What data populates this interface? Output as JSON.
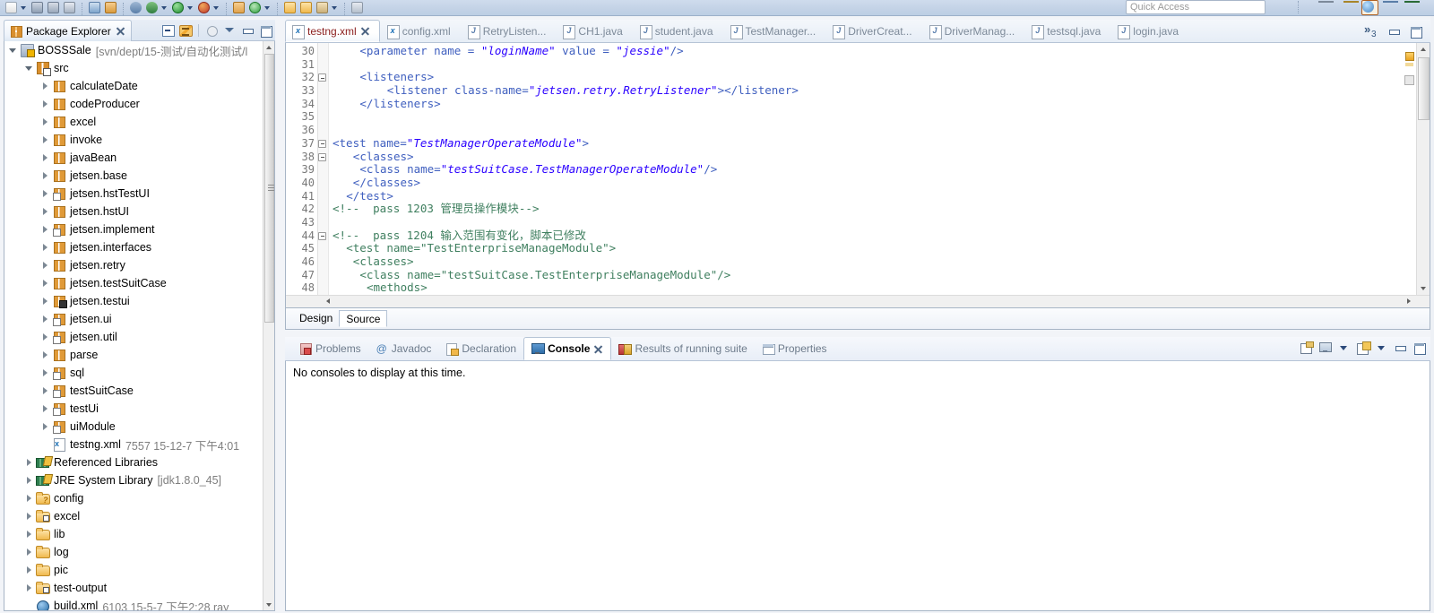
{
  "toolbar": {
    "quick_access_placeholder": "Quick Access",
    "icons": [
      "new-file-icon",
      "new-dropdown-arrow",
      "save-icon",
      "save-all-icon",
      "print-icon",
      "export-icon",
      "package-icon",
      "debug-icon",
      "debug-dropdown-arrow",
      "run-icon",
      "run-dropdown-arrow",
      "run-coverage-icon",
      "coverage-dropdown-arrow",
      "new-java-package-icon",
      "refresh-icon",
      "refresh-dropdown-arrow",
      "open-type-icon",
      "open-resource-icon",
      "search-icon",
      "search-dropdown-arrow",
      "edit-icon"
    ],
    "right_icons": [
      "new-window-icon",
      "open-perspective-icon",
      "java-perspective-icon",
      "java-ee-perspective-icon",
      "debug-perspective-icon"
    ]
  },
  "package_explorer": {
    "tab_label": "Package Explorer",
    "tools": [
      "collapse-all-icon",
      "link-with-editor-icon",
      "focus-on-active-task-icon",
      "view-menu-icon",
      "minimize-icon",
      "maximize-icon"
    ],
    "tree": [
      {
        "indent": 0,
        "twist": "open",
        "icon": "project-icon",
        "label": "BOSSSale",
        "sub": "[svn/dept/15-测试/自动化测试/l"
      },
      {
        "indent": 1,
        "twist": "open",
        "icon": "source-folder-icon",
        "label": "src",
        "sub": ""
      },
      {
        "indent": 2,
        "twist": "closed",
        "icon": "package-icon",
        "label": "calculateDate",
        "sub": ""
      },
      {
        "indent": 2,
        "twist": "closed",
        "icon": "package-icon",
        "label": "codeProducer",
        "sub": ""
      },
      {
        "indent": 2,
        "twist": "closed",
        "icon": "package-icon",
        "label": "excel",
        "sub": ""
      },
      {
        "indent": 2,
        "twist": "closed",
        "icon": "package-icon",
        "label": "invoke",
        "sub": ""
      },
      {
        "indent": 2,
        "twist": "closed",
        "icon": "package-icon",
        "label": "javaBean",
        "sub": ""
      },
      {
        "indent": 2,
        "twist": "closed",
        "icon": "package-icon",
        "label": "jetsen.base",
        "sub": ""
      },
      {
        "indent": 2,
        "twist": "closed",
        "icon": "package-modified-icon",
        "label": "jetsen.hstTestUI",
        "sub": ""
      },
      {
        "indent": 2,
        "twist": "closed",
        "icon": "package-icon",
        "label": "jetsen.hstUI",
        "sub": ""
      },
      {
        "indent": 2,
        "twist": "closed",
        "icon": "package-modified-icon",
        "label": "jetsen.implement",
        "sub": ""
      },
      {
        "indent": 2,
        "twist": "closed",
        "icon": "package-icon",
        "label": "jetsen.interfaces",
        "sub": ""
      },
      {
        "indent": 2,
        "twist": "closed",
        "icon": "package-icon",
        "label": "jetsen.retry",
        "sub": ""
      },
      {
        "indent": 2,
        "twist": "closed",
        "icon": "package-icon",
        "label": "jetsen.testSuitCase",
        "sub": ""
      },
      {
        "indent": 2,
        "twist": "closed",
        "icon": "package-checked-icon",
        "label": "jetsen.testui",
        "sub": ""
      },
      {
        "indent": 2,
        "twist": "closed",
        "icon": "package-modified-icon",
        "label": "jetsen.ui",
        "sub": ""
      },
      {
        "indent": 2,
        "twist": "closed",
        "icon": "package-modified-icon",
        "label": "jetsen.util",
        "sub": ""
      },
      {
        "indent": 2,
        "twist": "closed",
        "icon": "package-icon",
        "label": "parse",
        "sub": ""
      },
      {
        "indent": 2,
        "twist": "closed",
        "icon": "package-modified-icon",
        "label": "sql",
        "sub": ""
      },
      {
        "indent": 2,
        "twist": "closed",
        "icon": "package-modified-icon",
        "label": "testSuitCase",
        "sub": ""
      },
      {
        "indent": 2,
        "twist": "closed",
        "icon": "package-modified-icon",
        "label": "testUi",
        "sub": ""
      },
      {
        "indent": 2,
        "twist": "closed",
        "icon": "package-modified-icon",
        "label": "uiModule",
        "sub": ""
      },
      {
        "indent": 2,
        "twist": "none",
        "icon": "xml-file-icon",
        "label": "testng.xml",
        "sub": "7557  15-12-7 下午4:01"
      },
      {
        "indent": 1,
        "twist": "closed",
        "icon": "library-icon",
        "label": "Referenced Libraries",
        "sub": ""
      },
      {
        "indent": 1,
        "twist": "closed",
        "icon": "library-icon",
        "label": "JRE System Library",
        "sub": "[jdk1.8.0_45]"
      },
      {
        "indent": 1,
        "twist": "closed",
        "icon": "folder-question-icon",
        "label": "config",
        "sub": ""
      },
      {
        "indent": 1,
        "twist": "closed",
        "icon": "folder-modified-icon",
        "label": "excel",
        "sub": ""
      },
      {
        "indent": 1,
        "twist": "closed",
        "icon": "folder-icon",
        "label": "lib",
        "sub": ""
      },
      {
        "indent": 1,
        "twist": "closed",
        "icon": "folder-icon",
        "label": "log",
        "sub": ""
      },
      {
        "indent": 1,
        "twist": "closed",
        "icon": "folder-icon",
        "label": "pic",
        "sub": ""
      },
      {
        "indent": 1,
        "twist": "closed",
        "icon": "folder-modified-icon",
        "label": "test-output",
        "sub": ""
      },
      {
        "indent": 1,
        "twist": "none",
        "icon": "ant-build-icon",
        "label": "build.xml",
        "sub": "6103  15-5-7 下午2:28  ray"
      }
    ]
  },
  "editor": {
    "tabs": [
      {
        "label": "testng.xml",
        "kind": "x",
        "active": true,
        "closeable": true
      },
      {
        "label": "config.xml",
        "kind": "x",
        "active": false,
        "closeable": false
      },
      {
        "label": "RetryListen...",
        "kind": "j",
        "active": false,
        "closeable": false
      },
      {
        "label": "CH1.java",
        "kind": "j",
        "active": false,
        "closeable": false
      },
      {
        "label": "student.java",
        "kind": "j",
        "active": false,
        "closeable": false
      },
      {
        "label": "TestManager...",
        "kind": "j",
        "active": false,
        "closeable": false
      },
      {
        "label": "DriverCreat...",
        "kind": "j",
        "active": false,
        "closeable": false
      },
      {
        "label": "DriverManag...",
        "kind": "j",
        "active": false,
        "closeable": false
      },
      {
        "label": "testsql.java",
        "kind": "j",
        "active": false,
        "closeable": false
      },
      {
        "label": "login.java",
        "kind": "j",
        "active": false,
        "closeable": false
      }
    ],
    "more_chevron": "»",
    "more_count": "3",
    "window_controls": [
      "restore-icon",
      "maximize-icon"
    ],
    "bottom_tabs": [
      {
        "label": "Design",
        "active": false
      },
      {
        "label": "Source",
        "active": true
      }
    ],
    "code": [
      {
        "n": "30",
        "fold": false,
        "indent": 4,
        "parts": [
          {
            "t": "<parameter name = ",
            "c": "tag"
          },
          {
            "t": "\"loginName\"",
            "c": "str"
          },
          {
            "t": " value = ",
            "c": "tag"
          },
          {
            "t": "\"jessie\"",
            "c": "str"
          },
          {
            "t": "/>",
            "c": "tag"
          }
        ]
      },
      {
        "n": "31",
        "fold": false,
        "indent": 0,
        "parts": []
      },
      {
        "n": "32",
        "fold": true,
        "indent": 4,
        "parts": [
          {
            "t": "<listeners>",
            "c": "tag"
          }
        ]
      },
      {
        "n": "33",
        "fold": false,
        "indent": 8,
        "parts": [
          {
            "t": "<listener class-name=",
            "c": "tag"
          },
          {
            "t": "\"jetsen.retry.RetryListener\"",
            "c": "str"
          },
          {
            "t": "></listener>",
            "c": "tag"
          }
        ]
      },
      {
        "n": "34",
        "fold": false,
        "indent": 4,
        "parts": [
          {
            "t": "</listeners>",
            "c": "tag"
          }
        ]
      },
      {
        "n": "35",
        "fold": false,
        "indent": 0,
        "parts": []
      },
      {
        "n": "36",
        "fold": false,
        "indent": 0,
        "parts": []
      },
      {
        "n": "37",
        "fold": true,
        "indent": 0,
        "parts": [
          {
            "t": "<test name=",
            "c": "tag"
          },
          {
            "t": "\"TestManagerOperateModule\"",
            "c": "str"
          },
          {
            "t": ">",
            "c": "tag"
          }
        ]
      },
      {
        "n": "38",
        "fold": true,
        "indent": 3,
        "parts": [
          {
            "t": "<classes>",
            "c": "tag"
          }
        ]
      },
      {
        "n": "39",
        "fold": false,
        "indent": 4,
        "parts": [
          {
            "t": "<class name=",
            "c": "tag"
          },
          {
            "t": "\"testSuitCase.TestManagerOperateModule\"",
            "c": "str"
          },
          {
            "t": "/>",
            "c": "tag"
          }
        ]
      },
      {
        "n": "40",
        "fold": false,
        "indent": 3,
        "parts": [
          {
            "t": "</classes>",
            "c": "tag"
          }
        ]
      },
      {
        "n": "41",
        "fold": false,
        "indent": 2,
        "parts": [
          {
            "t": "</test>",
            "c": "tag"
          }
        ]
      },
      {
        "n": "42",
        "fold": false,
        "indent": 0,
        "parts": [
          {
            "t": "<!--  pass 1203 管理员操作模块-->",
            "c": "cmt"
          }
        ]
      },
      {
        "n": "43",
        "fold": false,
        "indent": 0,
        "parts": []
      },
      {
        "n": "44",
        "fold": true,
        "indent": 0,
        "parts": [
          {
            "t": "<!--  pass 1204 输入范围有变化，脚本已修改",
            "c": "cmt"
          }
        ]
      },
      {
        "n": "45",
        "fold": false,
        "indent": 2,
        "parts": [
          {
            "t": "<test name=\"TestEnterpriseManageModule\">",
            "c": "cmt"
          }
        ]
      },
      {
        "n": "46",
        "fold": false,
        "indent": 3,
        "parts": [
          {
            "t": "<classes>",
            "c": "cmt"
          }
        ]
      },
      {
        "n": "47",
        "fold": false,
        "indent": 4,
        "parts": [
          {
            "t": "<class name=\"testSuitCase.TestEnterpriseManageModule\"/>",
            "c": "cmt"
          }
        ]
      },
      {
        "n": "48",
        "fold": false,
        "indent": 5,
        "parts": [
          {
            "t": "<methods>",
            "c": "cmt"
          }
        ]
      }
    ]
  },
  "console": {
    "tabs": [
      {
        "label": "Problems",
        "icon": "problems-icon",
        "active": false,
        "closeable": false
      },
      {
        "label": "Javadoc",
        "icon": "javadoc-icon",
        "active": false,
        "closeable": false
      },
      {
        "label": "Declaration",
        "icon": "declaration-icon",
        "active": false,
        "closeable": false
      },
      {
        "label": "Console",
        "icon": "console-icon",
        "active": true,
        "closeable": true
      },
      {
        "label": "Results of running suite",
        "icon": "test-suite-icon",
        "active": false,
        "closeable": false
      },
      {
        "label": "Properties",
        "icon": "properties-icon",
        "active": false,
        "closeable": false
      }
    ],
    "tools": [
      "pin-console-icon",
      "display-selected-console-icon",
      "open-console-dropdown-icon",
      "minimize-icon",
      "maximize-icon"
    ],
    "message": "No consoles to display at this time."
  }
}
